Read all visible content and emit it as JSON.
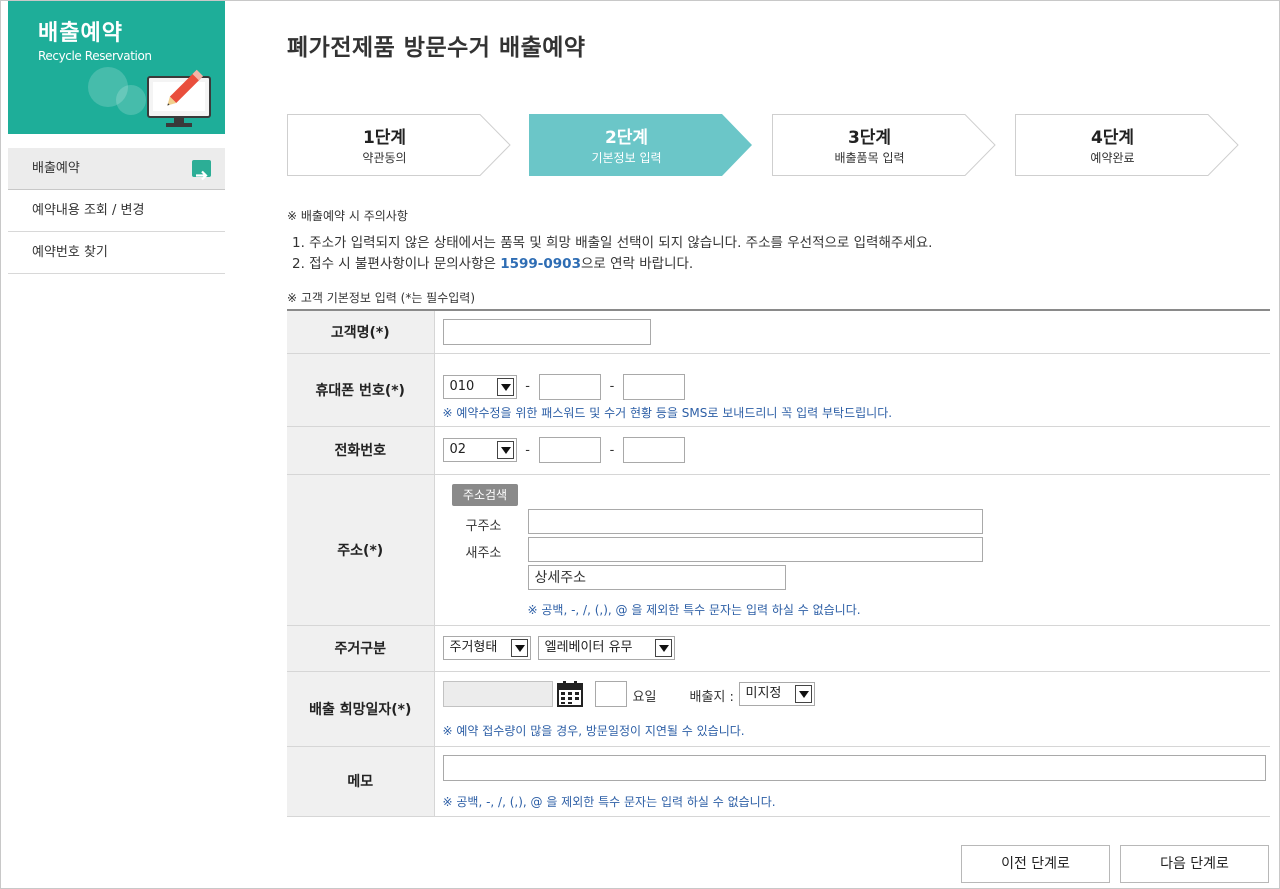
{
  "sidebar": {
    "banner_title": "배출예약",
    "banner_subtitle": "Recycle Reservation",
    "items": [
      {
        "label": "배출예약"
      },
      {
        "label": "예약내용 조회 / 변경"
      },
      {
        "label": "예약번호 찾기"
      }
    ]
  },
  "page": {
    "title": "폐가전제품 방문수거 배출예약"
  },
  "steps": [
    {
      "num": "1단계",
      "label": "약관동의"
    },
    {
      "num": "2단계",
      "label": "기본정보 입력"
    },
    {
      "num": "3단계",
      "label": "배출품목 입력"
    },
    {
      "num": "4단계",
      "label": "예약완료"
    }
  ],
  "notice": {
    "heading": "※ 배출예약 시 주의사항",
    "line1": "1. 주소가 입력되지 않은 상태에서는 품목 및 희망 배출일 선택이 되지 않습니다. 주소를 우선적으로 입력해주세요.",
    "line2_prefix": "2. 접수 시 불편사항이나 문의사항은 ",
    "line2_phone": "1599-0903",
    "line2_suffix": "으로 연락 바랍니다."
  },
  "form": {
    "heading": "※ 고객 기본정보 입력 (*는 필수입력)",
    "name_label": "고객명(*)",
    "mobile_label": "휴대폰 번호(*)",
    "mobile_prefix": "010",
    "mobile_hint": "※ 예약수정을 위한 패스워드 및 수거 현황 등을 SMS로 보내드리니 꼭 입력 부탁드립니다.",
    "phone_label": "전화번호",
    "phone_prefix": "02",
    "address_label": "주소(*)",
    "address_search_button": "주소검색",
    "old_address_label": "구주소",
    "new_address_label": "새주소",
    "detail_address_placeholder": "상세주소",
    "address_hint": "※ 공백, -, /, (,), @ 을 제외한 특수 문자는 입력 하실 수 없습니다.",
    "residence_label": "주거구분",
    "residence_type": "주거형태",
    "elevator": "엘레베이터 유무",
    "date_label": "배출 희망일자(*)",
    "weekday_suffix": "요일",
    "location_label": "배출지 :",
    "location_value": "미지정",
    "date_hint": "※ 예약 접수량이 많을 경우, 방문일정이 지연될 수 있습니다.",
    "memo_label": "메모",
    "memo_hint": "※ 공백, -, /, (,), @ 을 제외한 특수 문자는 입력 하실 수 없습니다."
  },
  "buttons": {
    "prev": "이전 단계로",
    "next": "다음 단계로"
  },
  "colors": {
    "brand": "#1eae99",
    "active_step": "#6bc6c8",
    "link": "#2e6db4",
    "hint": "#2d5fa6"
  }
}
